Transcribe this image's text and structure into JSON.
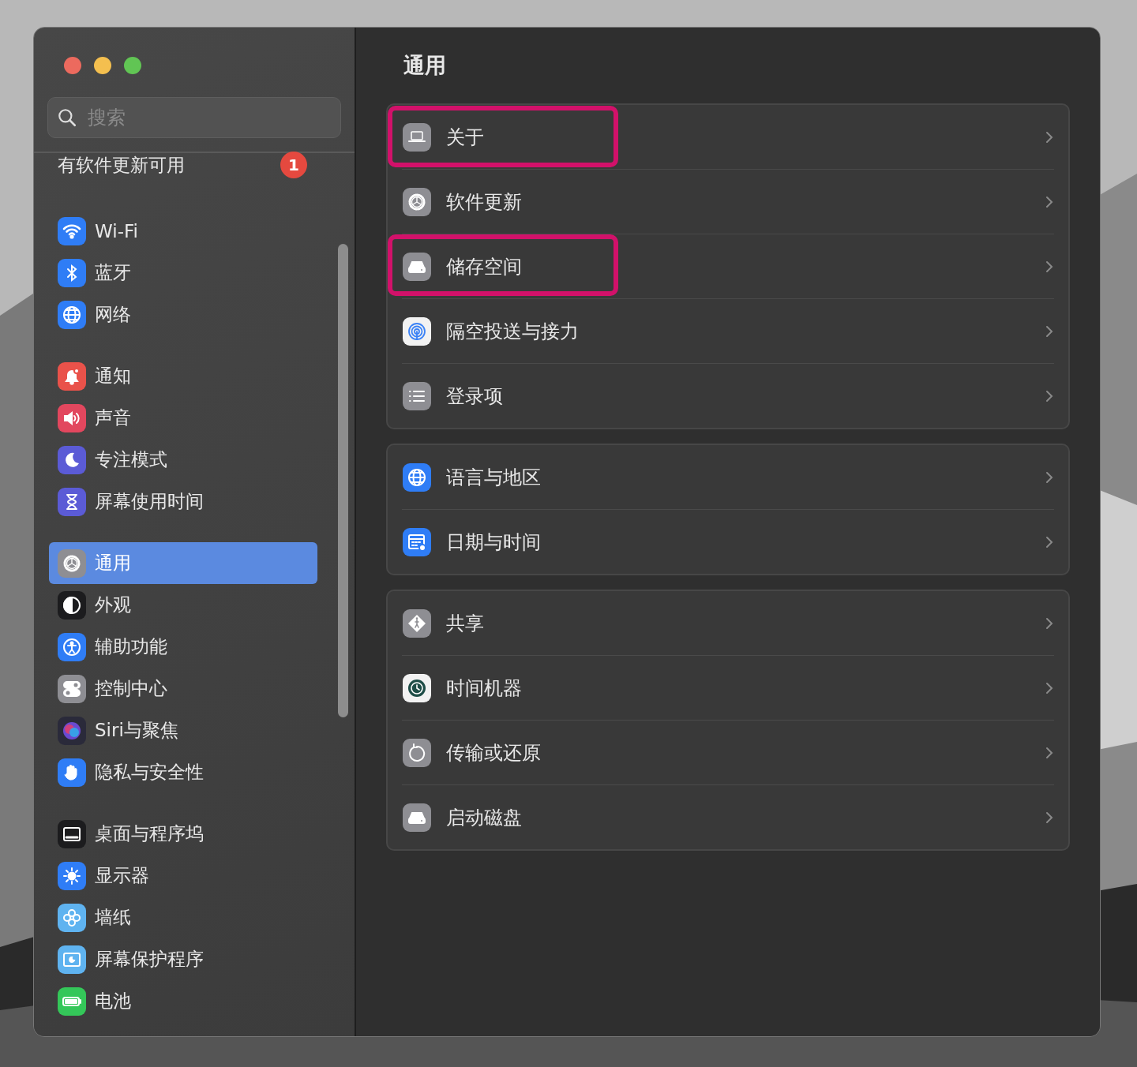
{
  "sidebar": {
    "search": {
      "placeholder": "搜索"
    },
    "update_notice": {
      "label": "有软件更新可用",
      "badge": "1"
    },
    "groups": [
      {
        "items": [
          {
            "label": "Wi-Fi",
            "selected": false
          },
          {
            "label": "蓝牙",
            "selected": false
          },
          {
            "label": "网络",
            "selected": false
          }
        ]
      },
      {
        "items": [
          {
            "label": "通知",
            "selected": false
          },
          {
            "label": "声音",
            "selected": false
          },
          {
            "label": "专注模式",
            "selected": false
          },
          {
            "label": "屏幕使用时间",
            "selected": false
          }
        ]
      },
      {
        "items": [
          {
            "label": "通用",
            "selected": true
          },
          {
            "label": "外观",
            "selected": false
          },
          {
            "label": "辅助功能",
            "selected": false
          },
          {
            "label": "控制中心",
            "selected": false
          },
          {
            "label": "Siri与聚焦",
            "selected": false
          },
          {
            "label": "隐私与安全性",
            "selected": false
          }
        ]
      },
      {
        "items": [
          {
            "label": "桌面与程序坞",
            "selected": false
          },
          {
            "label": "显示器",
            "selected": false
          },
          {
            "label": "墙纸",
            "selected": false
          },
          {
            "label": "屏幕保护程序",
            "selected": false
          },
          {
            "label": "电池",
            "selected": false
          }
        ]
      }
    ]
  },
  "content": {
    "title": "通用",
    "groups": [
      {
        "items": [
          {
            "label": "关于",
            "highlighted": true
          },
          {
            "label": "软件更新",
            "highlighted": false
          },
          {
            "label": "储存空间",
            "highlighted": true
          },
          {
            "label": "隔空投送与接力",
            "highlighted": false
          },
          {
            "label": "登录项",
            "highlighted": false
          }
        ]
      },
      {
        "items": [
          {
            "label": "语言与地区",
            "highlighted": false
          },
          {
            "label": "日期与时间",
            "highlighted": false
          }
        ]
      },
      {
        "items": [
          {
            "label": "共享",
            "highlighted": false
          },
          {
            "label": "时间机器",
            "highlighted": false
          },
          {
            "label": "传输或还原",
            "highlighted": false
          },
          {
            "label": "启动磁盘",
            "highlighted": false
          }
        ]
      }
    ]
  }
}
